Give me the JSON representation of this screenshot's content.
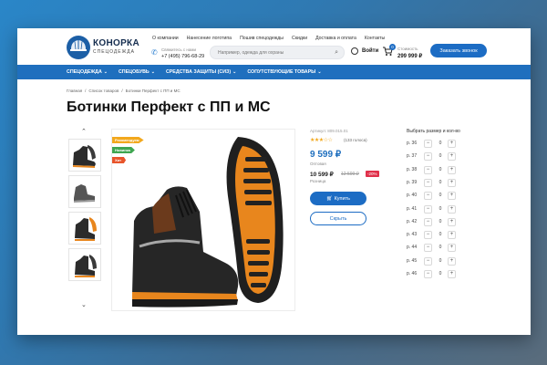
{
  "header": {
    "brand_name": "КОНОРКА",
    "brand_sub": "СПЕЦОДЕЖДА",
    "top_links": [
      "О компании",
      "Нанесение логотипа",
      "Пошив спецодежды",
      "Скидки",
      "Доставка и оплата",
      "Контакты"
    ],
    "phone_label": "Свяжитесь с нами",
    "phone": "+7 (495) 796-68-29",
    "search_placeholder": "Например, одежда для охраны",
    "login_label": "Войти",
    "cart_count": "0",
    "cost_label": "Стоимость",
    "cost_value": "299 999 ₽",
    "callback_label": "Заказать звонок"
  },
  "nav": [
    "СПЕЦОДЕЖДА",
    "СПЕЦОБУВЬ",
    "СРЕДСТВА ЗАЩИТЫ (СИЗ)",
    "СОПУТСТВУЮЩИЕ ТОВАРЫ"
  ],
  "breadcrumb": [
    "Главная",
    "/",
    "Список товаров",
    "/",
    "Ботинки Перфект с ПП и МС"
  ],
  "product": {
    "title": "Ботинки Перфект с ПП и МС",
    "badges": [
      {
        "label": "Рекомендуем",
        "color": "#f2a81d"
      },
      {
        "label": "Новинка",
        "color": "#3fa651"
      },
      {
        "label": "Хит",
        "color": "#e8542a"
      }
    ],
    "article": "Артикул: 809.015.01",
    "rating": "★★★☆☆",
    "votes": "(133 голоса)",
    "price_opt": "9 599 ₽",
    "price_opt_label": "Оптовая",
    "price_retail": "10 599 ₽",
    "price_old": "12 599 ₽",
    "discount": "-20%",
    "price_retail_label": "Розница",
    "buy_label": "Купить",
    "hide_label": "Скрыть"
  },
  "sizes": {
    "title": "Выбрать размер и кол-во",
    "items": [
      {
        "label": "р. 36",
        "qty": "0"
      },
      {
        "label": "р. 37",
        "qty": "0"
      },
      {
        "label": "р. 38",
        "qty": "0"
      },
      {
        "label": "р. 39",
        "qty": "0"
      },
      {
        "label": "р. 40",
        "qty": "0"
      },
      {
        "label": "р. 41",
        "qty": "0"
      },
      {
        "label": "р. 42",
        "qty": "0"
      },
      {
        "label": "р. 43",
        "qty": "0"
      },
      {
        "label": "р. 44",
        "qty": "0"
      },
      {
        "label": "р. 45",
        "qty": "0"
      },
      {
        "label": "р. 46",
        "qty": "0"
      }
    ]
  },
  "colors": {
    "accent": "#1f6fbe",
    "button": "#1c6cc4",
    "discount": "#e0304a"
  },
  "icons": {
    "search": "search-icon",
    "user": "user-icon",
    "cart": "cart-icon",
    "phone": "phone-icon"
  }
}
